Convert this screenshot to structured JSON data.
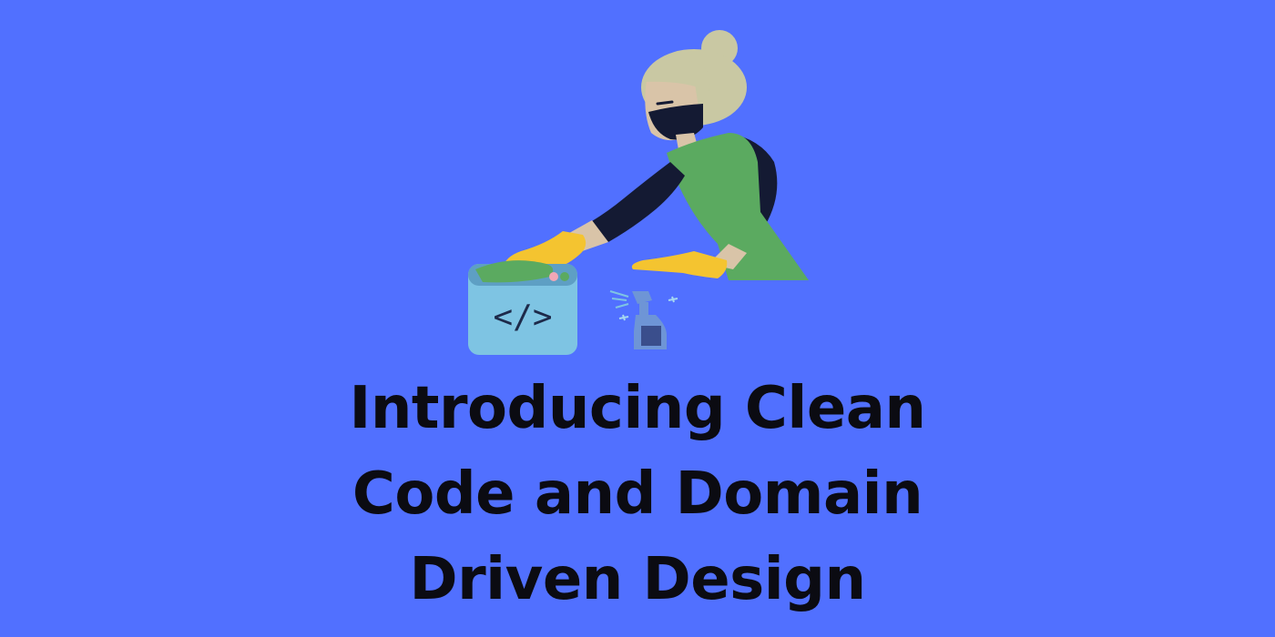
{
  "title": {
    "lines": [
      "Introducing Clean",
      "Code and Domain",
      "Driven Design"
    ]
  },
  "illustration": {
    "code_window_symbol": "</>",
    "icons": [
      "cleaner-person-icon",
      "code-window-icon",
      "spray-bottle-icon"
    ]
  },
  "colors": {
    "background": "#5170FF",
    "title_text": "#0b0b12",
    "apron": "#5BAA60",
    "sleeve": "#141A33",
    "glove": "#F4C430",
    "hair": "#C9C8A3",
    "skin": "#D9C4A8",
    "code_window": "#7EC4E3"
  }
}
